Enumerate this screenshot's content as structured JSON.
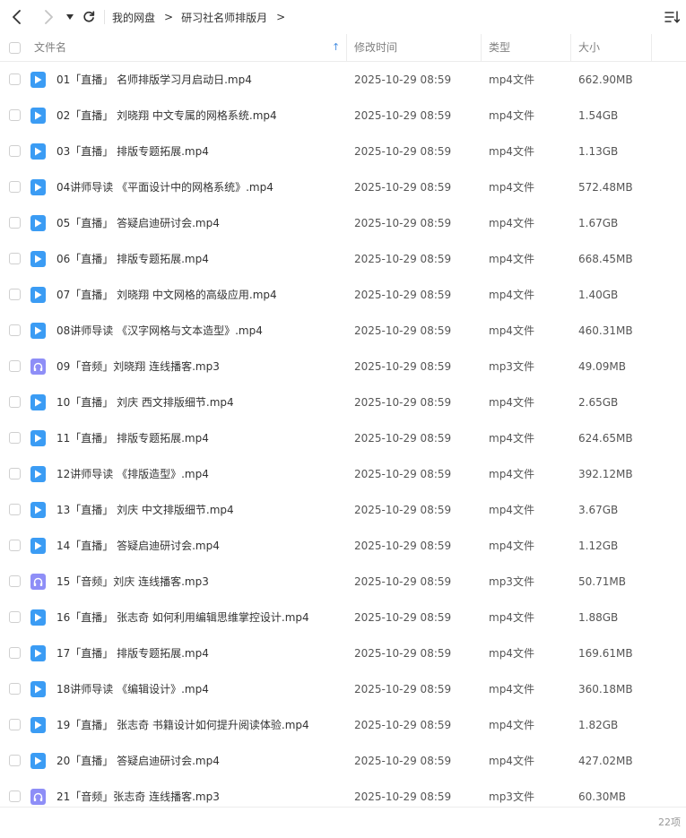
{
  "toolbar": {
    "breadcrumb": [
      "我的网盘",
      "研习社名师排版月"
    ],
    "crumb_separator": ">"
  },
  "columns": {
    "name": "文件名",
    "modified": "修改时间",
    "type": "类型",
    "size": "大小",
    "sort_indicator": "↑"
  },
  "colors": {
    "video_icon": "#3b9cf4",
    "audio_icon": "#8e8ef7",
    "sort_arrow": "#4a90e2"
  },
  "files": [
    {
      "name": "01「直播」 名师排版学习月启动日.mp4",
      "modified": "2025-10-29 08:59",
      "type": "mp4文件",
      "size": "662.90MB",
      "icon": "video-file-icon"
    },
    {
      "name": "02「直播」 刘晓翔 中文专属的网格系统.mp4",
      "modified": "2025-10-29 08:59",
      "type": "mp4文件",
      "size": "1.54GB",
      "icon": "video-file-icon"
    },
    {
      "name": "03「直播」 排版专题拓展.mp4",
      "modified": "2025-10-29 08:59",
      "type": "mp4文件",
      "size": "1.13GB",
      "icon": "video-file-icon"
    },
    {
      "name": "04讲师导读 《平面设计中的网格系统》.mp4",
      "modified": "2025-10-29 08:59",
      "type": "mp4文件",
      "size": "572.48MB",
      "icon": "video-file-icon"
    },
    {
      "name": "05「直播」 答疑启迪研讨会.mp4",
      "modified": "2025-10-29 08:59",
      "type": "mp4文件",
      "size": "1.67GB",
      "icon": "video-file-icon"
    },
    {
      "name": "06「直播」 排版专题拓展.mp4",
      "modified": "2025-10-29 08:59",
      "type": "mp4文件",
      "size": "668.45MB",
      "icon": "video-file-icon"
    },
    {
      "name": "07「直播」 刘晓翔 中文网格的高级应用.mp4",
      "modified": "2025-10-29 08:59",
      "type": "mp4文件",
      "size": "1.40GB",
      "icon": "video-file-icon"
    },
    {
      "name": "08讲师导读 《汉字网格与文本造型》.mp4",
      "modified": "2025-10-29 08:59",
      "type": "mp4文件",
      "size": "460.31MB",
      "icon": "video-file-icon"
    },
    {
      "name": "09「音频」刘晓翔 连线播客.mp3",
      "modified": "2025-10-29 08:59",
      "type": "mp3文件",
      "size": "49.09MB",
      "icon": "audio-file-icon"
    },
    {
      "name": "10「直播」 刘庆 西文排版细节.mp4",
      "modified": "2025-10-29 08:59",
      "type": "mp4文件",
      "size": "2.65GB",
      "icon": "video-file-icon"
    },
    {
      "name": "11「直播」 排版专题拓展.mp4",
      "modified": "2025-10-29 08:59",
      "type": "mp4文件",
      "size": "624.65MB",
      "icon": "video-file-icon"
    },
    {
      "name": "12讲师导读 《排版造型》.mp4",
      "modified": "2025-10-29 08:59",
      "type": "mp4文件",
      "size": "392.12MB",
      "icon": "video-file-icon"
    },
    {
      "name": "13「直播」 刘庆 中文排版细节.mp4",
      "modified": "2025-10-29 08:59",
      "type": "mp4文件",
      "size": "3.67GB",
      "icon": "video-file-icon"
    },
    {
      "name": "14「直播」 答疑启迪研讨会.mp4",
      "modified": "2025-10-29 08:59",
      "type": "mp4文件",
      "size": "1.12GB",
      "icon": "video-file-icon"
    },
    {
      "name": "15「音频」刘庆 连线播客.mp3",
      "modified": "2025-10-29 08:59",
      "type": "mp3文件",
      "size": "50.71MB",
      "icon": "audio-file-icon"
    },
    {
      "name": "16「直播」 张志奇 如何利用编辑思维掌控设计.mp4",
      "modified": "2025-10-29 08:59",
      "type": "mp4文件",
      "size": "1.88GB",
      "icon": "video-file-icon"
    },
    {
      "name": "17「直播」 排版专题拓展.mp4",
      "modified": "2025-10-29 08:59",
      "type": "mp4文件",
      "size": "169.61MB",
      "icon": "video-file-icon"
    },
    {
      "name": "18讲师导读 《编辑设计》.mp4",
      "modified": "2025-10-29 08:59",
      "type": "mp4文件",
      "size": "360.18MB",
      "icon": "video-file-icon"
    },
    {
      "name": "19「直播」 张志奇 书籍设计如何提升阅读体验.mp4",
      "modified": "2025-10-29 08:59",
      "type": "mp4文件",
      "size": "1.82GB",
      "icon": "video-file-icon"
    },
    {
      "name": "20「直播」 答疑启迪研讨会.mp4",
      "modified": "2025-10-29 08:59",
      "type": "mp4文件",
      "size": "427.02MB",
      "icon": "video-file-icon"
    },
    {
      "name": "21「音频」张志奇 连线播客.mp3",
      "modified": "2025-10-29 08:59",
      "type": "mp3文件",
      "size": "60.30MB",
      "icon": "audio-file-icon"
    }
  ],
  "footer": {
    "count": "22项"
  }
}
